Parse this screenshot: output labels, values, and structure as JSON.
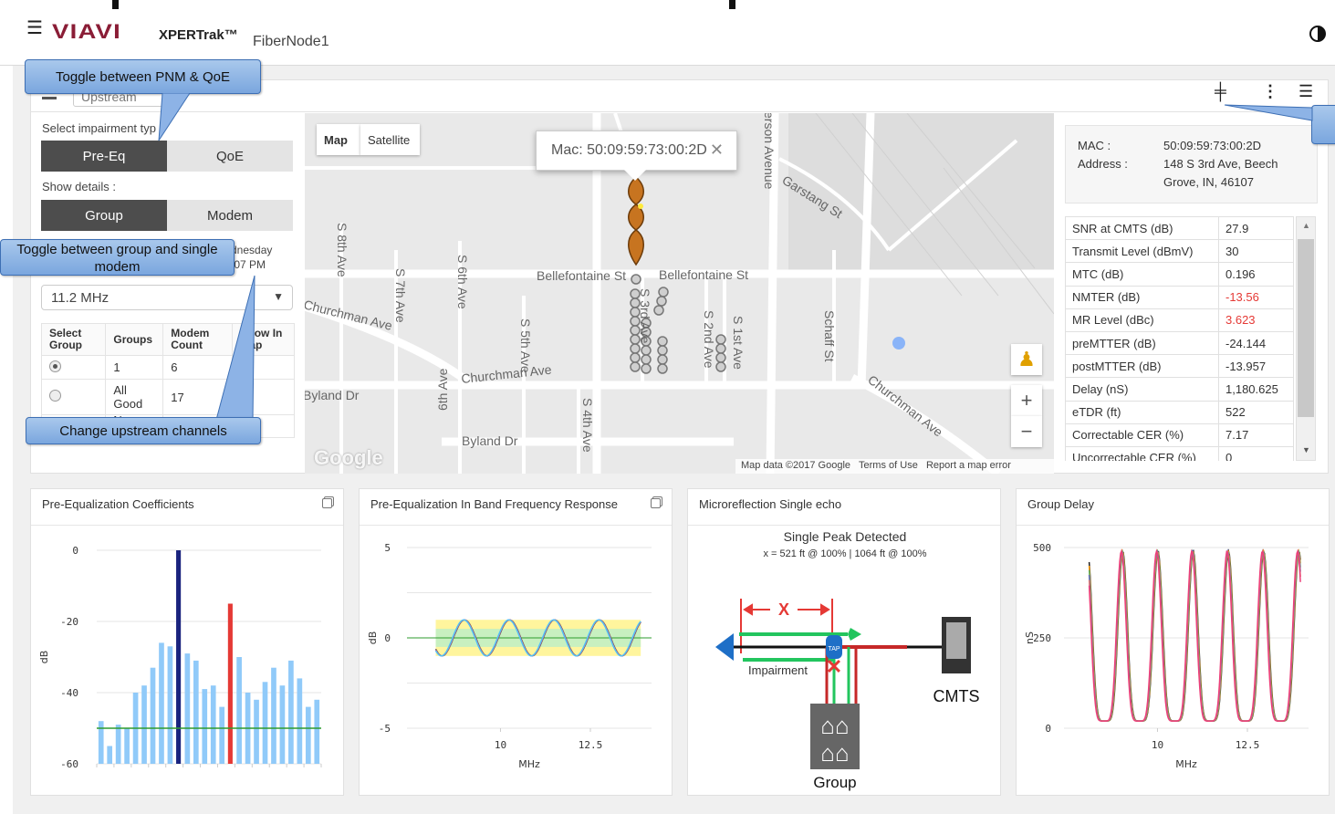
{
  "app": {
    "brand": "VIAVI",
    "product": "XPERTrak™",
    "node": "FiberNode1"
  },
  "panel": {
    "view_select": "Upstream"
  },
  "left": {
    "impairment_label": "Select impairment typ",
    "impairment_options": [
      "Pre-Eq",
      "QoE"
    ],
    "details_label": "Show details :",
    "details_options": [
      "Group",
      "Modem"
    ],
    "time_line1": "dnesday",
    "time_line2": ":07 PM",
    "frequency": "11.2 MHz",
    "table_headers": [
      "Select Group",
      "Groups",
      "Modem Count",
      "Show In Map"
    ],
    "rows": [
      {
        "group": "1",
        "count": "6"
      },
      {
        "group": "All Good",
        "count": "17"
      },
      {
        "group": "No",
        "count": ""
      }
    ]
  },
  "map": {
    "tabs": [
      "Map",
      "Satellite"
    ],
    "popup": "Mac: 50:09:59:73:00:2D",
    "streets": [
      "S 8th Ave",
      "S 7th Ave",
      "S 6th Ave",
      "S 5th Ave",
      "S 4th Ave",
      "S 3rd Ave",
      "S 2nd Ave",
      "S 1st Ave",
      "Schaff St",
      "Bellefontaine St",
      "Bellefontaine St",
      "Churchman Ave",
      "Churchman Ave",
      "Churchman Ave",
      "Byland Dr",
      "Byland Dr",
      "Garstang St",
      "erson Avenue",
      "6th Ave"
    ],
    "google": "Google",
    "attribution": [
      "Map data ©2017 Google",
      "Terms of Use",
      "Report a map error"
    ]
  },
  "info": {
    "mac_label": "MAC :",
    "mac": "50:09:59:73:00:2D",
    "address_label": "Address :",
    "address_line1": "148 S 3rd Ave, Beech",
    "address_line2": "Grove, IN, 46107"
  },
  "metrics": [
    {
      "name": "SNR at CMTS (dB)",
      "value": "27.9"
    },
    {
      "name": "Transmit Level (dBmV)",
      "value": "30"
    },
    {
      "name": "MTC (dB)",
      "value": "0.196"
    },
    {
      "name": "NMTER (dB)",
      "value": "-13.56"
    },
    {
      "name": "MR Level (dBc)",
      "value": "3.623"
    },
    {
      "name": "preMTTER (dB)",
      "value": "-24.144"
    },
    {
      "name": "postMTTER (dB)",
      "value": "-13.957"
    },
    {
      "name": "Delay (nS)",
      "value": "1,180.625"
    },
    {
      "name": "eTDR (ft)",
      "value": "522"
    },
    {
      "name": "Correctable CER (%)",
      "value": "7.17"
    },
    {
      "name": "Uncorrectable CER (%)",
      "value": "0"
    }
  ],
  "colors": {
    "alert": "#e53935",
    "brand": "#8a1d36",
    "callout": "#8db3e6"
  },
  "cards": [
    {
      "title": "Pre-Equalization Coefficients"
    },
    {
      "title": "Pre-Equalization In Band Frequency Response"
    },
    {
      "title": "Microreflection Single echo",
      "line1": "Single Peak Detected",
      "line2": "x = 521 ft @ 100% | 1064 ft @ 100%",
      "impairment": "Impairment",
      "cmts": "CMTS",
      "group": "Group",
      "x_marker": "X",
      "tap": "TAP"
    },
    {
      "title": "Group Delay"
    }
  ],
  "callouts": {
    "pnm": "Toggle between PNM & QoE",
    "group": "Toggle between group and single modem",
    "channels": "Change upstream channels"
  },
  "chart_data": [
    {
      "type": "bar",
      "title": "",
      "ylabel": "dB",
      "ylim": [
        -60,
        0
      ],
      "yticks": [
        0,
        -20,
        -40,
        -60
      ],
      "reference": -50,
      "values": [
        -48,
        -55,
        -49,
        -50,
        -40,
        -38,
        -33,
        -26,
        -27,
        0,
        -29,
        -31,
        -39,
        -38,
        -44,
        -15,
        -30,
        -40,
        -42,
        -37,
        -33,
        -38,
        -31,
        -36,
        -44,
        -42
      ],
      "highlight": {
        "9": "#1a237e",
        "15": "#e53935"
      }
    },
    {
      "type": "line",
      "ylabel": "dB",
      "xlabel": "MHz",
      "ylim": [
        -5,
        5
      ],
      "yticks": [
        5,
        0,
        -5
      ],
      "xticks": [
        10,
        12.5
      ],
      "xlim": [
        7.4,
        14.2
      ],
      "band": {
        "outer": [
          -1,
          1
        ],
        "inner": [
          -0.5,
          0.5
        ]
      },
      "series": [
        {
          "amplitude": 0.95,
          "period": 1.25,
          "phase": 0.3
        }
      ]
    },
    {
      "type": "line",
      "ylabel": "nS",
      "xlabel": "MHz",
      "ylim": [
        0,
        500
      ],
      "yticks": [
        500,
        250,
        0
      ],
      "xticks": [
        10,
        12.5
      ],
      "xlim": [
        7.4,
        14.2
      ],
      "series": [
        {
          "period": 0.98,
          "phase": 0.2
        }
      ]
    }
  ]
}
